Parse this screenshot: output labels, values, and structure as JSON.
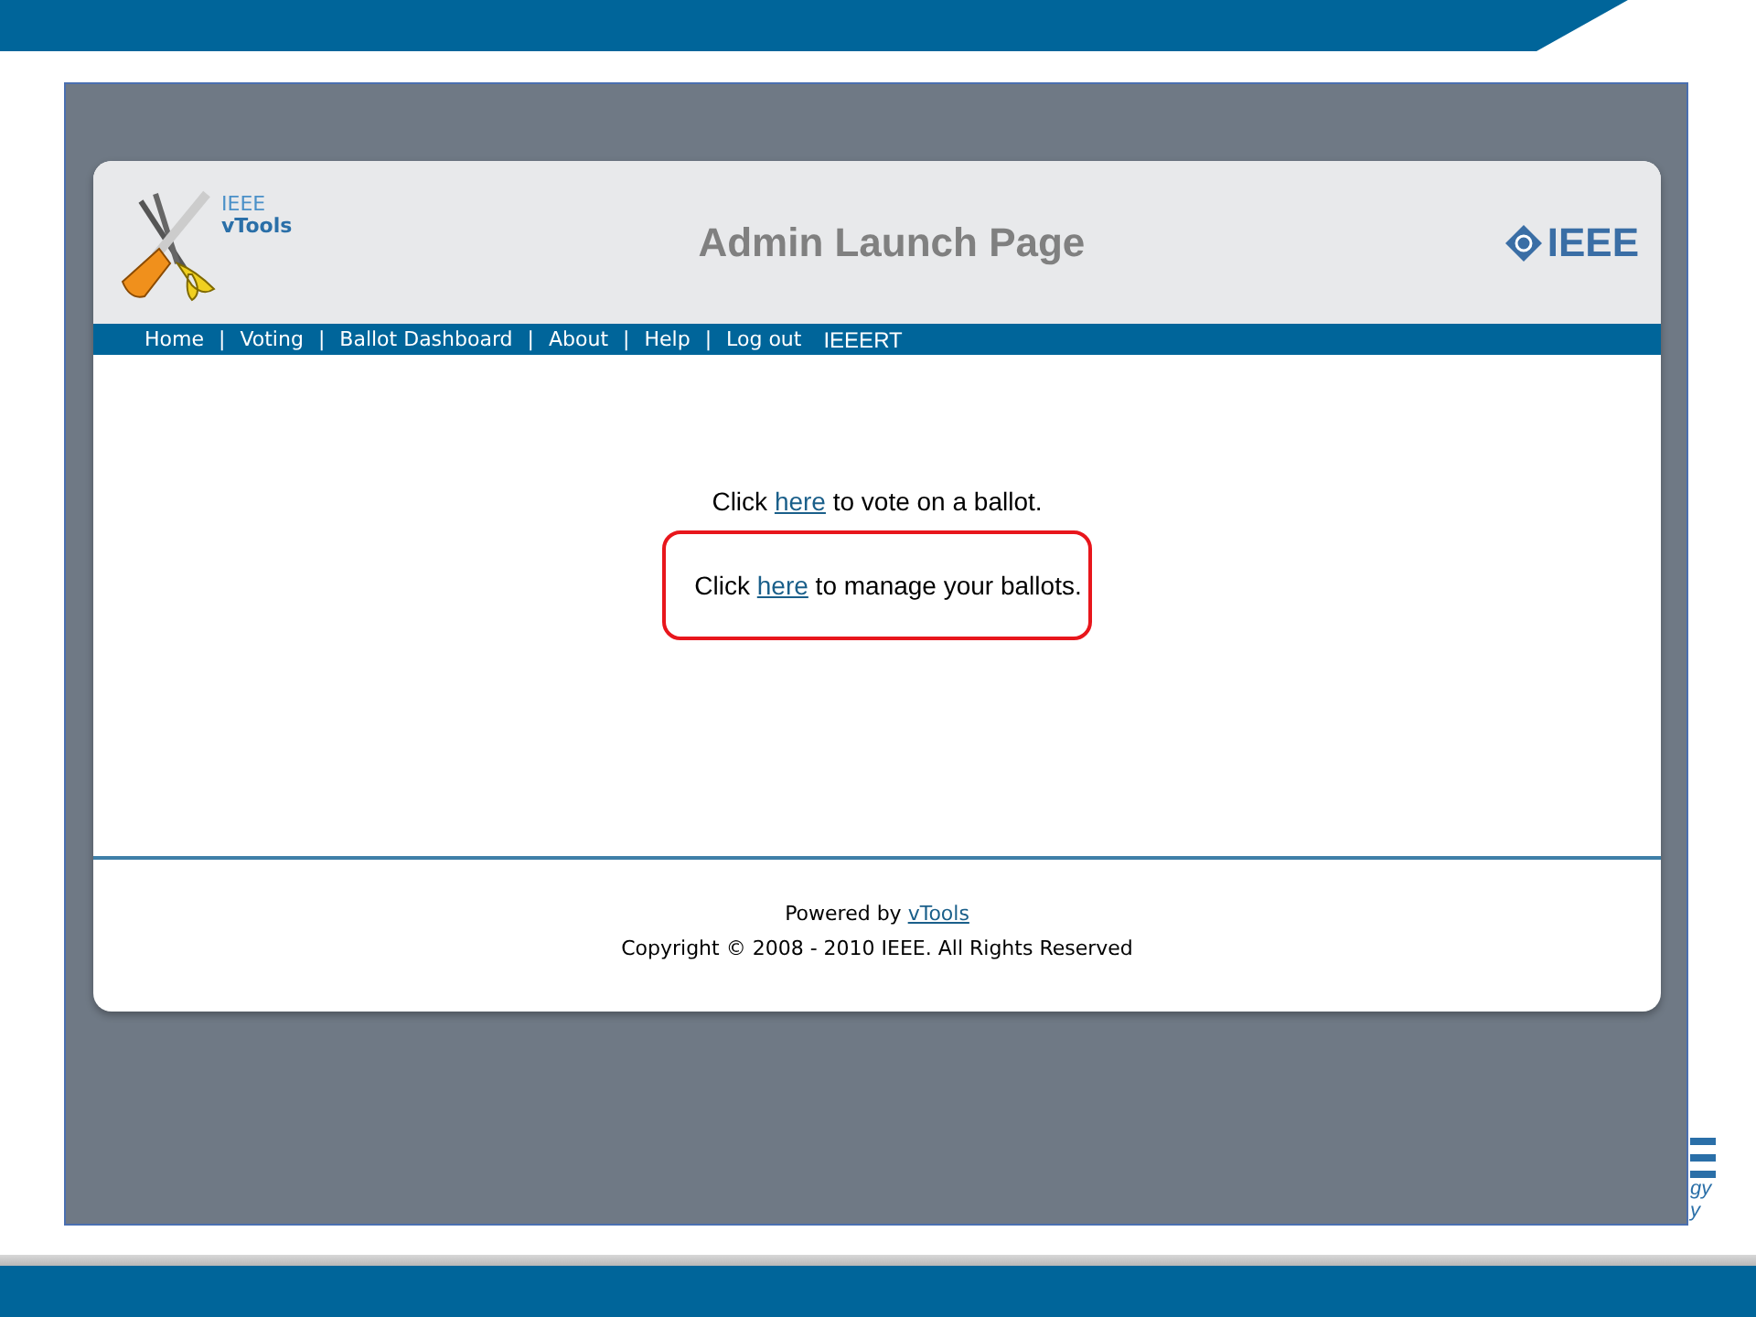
{
  "app": {
    "logo_line_1": "IEEE",
    "logo_line_2": "vTools",
    "title": "Admin Launch Page",
    "brand": "IEEE"
  },
  "nav": [
    {
      "kind": "link",
      "text": "Home"
    },
    {
      "kind": "separator",
      "text": "|"
    },
    {
      "kind": "link",
      "text": "Voting"
    },
    {
      "kind": "separator",
      "text": "|"
    },
    {
      "kind": "link",
      "text": "Ballot Dashboard"
    },
    {
      "kind": "separator",
      "text": "|"
    },
    {
      "kind": "link",
      "text": "About"
    },
    {
      "kind": "separator",
      "text": "|"
    },
    {
      "kind": "link",
      "text": "Help"
    },
    {
      "kind": "separator",
      "text": "|"
    },
    {
      "kind": "link",
      "text": "Log out"
    },
    {
      "kind": "user",
      "text": "IEEERT"
    }
  ],
  "content": [
    {
      "before": "Click ",
      "link": "here",
      "after": " to vote on a ballot.",
      "highlighted": false
    },
    {
      "before": "Click ",
      "link": "here",
      "after": " to manage your ballots.",
      "highlighted": true
    }
  ],
  "footer": {
    "powered_by": "Powered by ",
    "powered_link": "vTools",
    "copyright": "Copyright © 2008 - 2010 IEEE. All Rights Reserved"
  },
  "slide_fragments": [
    "gy",
    "y"
  ]
}
